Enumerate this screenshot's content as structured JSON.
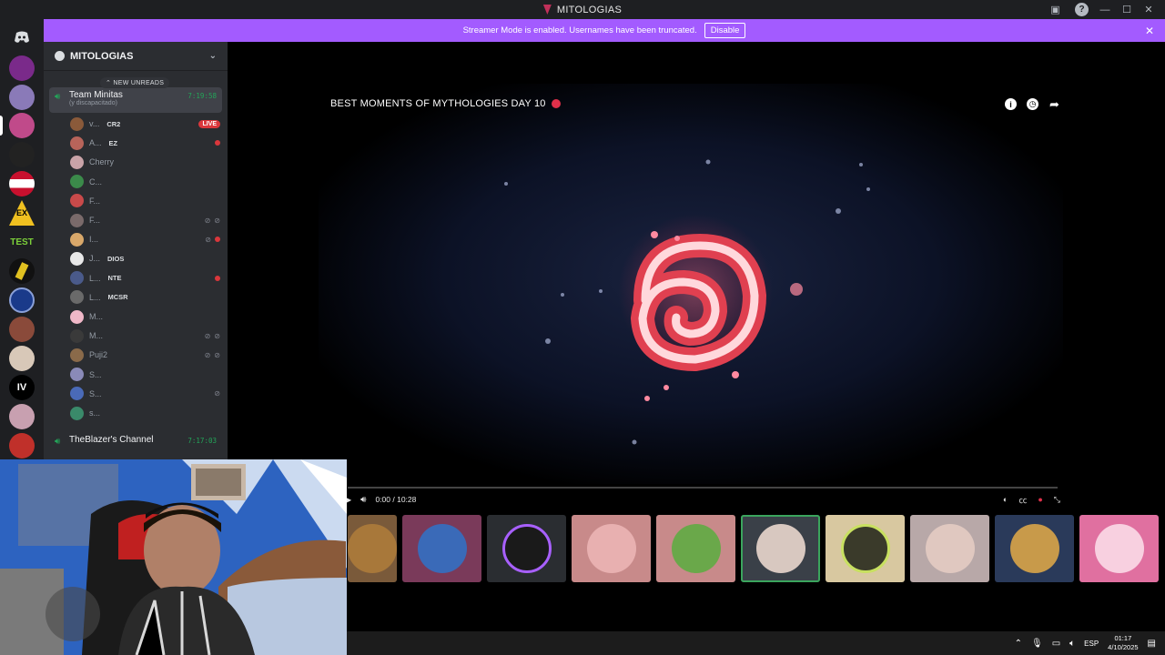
{
  "window": {
    "title": "MITOLOGIAS"
  },
  "banner": {
    "text": "Streamer Mode is enabled. Usernames have been truncated.",
    "disable_label": "Disable"
  },
  "server": {
    "name": "MITOLOGIAS"
  },
  "sidebar": {
    "new_unreads": "NEW UNREADS",
    "channels": [
      {
        "name": "Team Minitas",
        "subtitle": "(y discapacitado)",
        "time": "7:19:58"
      },
      {
        "name": "TheBlazer's Channel",
        "subtitle": "",
        "time": "7:17:03"
      }
    ],
    "members": [
      {
        "name": "v...",
        "tag": "CR2",
        "badge": "LIVE",
        "avatar": "#8a5a3a"
      },
      {
        "name": "A...",
        "tag": "EZ",
        "badge": "dot",
        "avatar": "#b8645a"
      },
      {
        "name": "Cherry",
        "tag": "",
        "badge": "",
        "avatar": "#c9a3a8"
      },
      {
        "name": "C...",
        "tag": "",
        "badge": "",
        "avatar": "#3b8a4a"
      },
      {
        "name": "F...",
        "tag": "",
        "badge": "",
        "avatar": "#c94a4a"
      },
      {
        "name": "F...",
        "tag": "",
        "badge": "muted",
        "avatar": "#7a6a6a"
      },
      {
        "name": "I...",
        "tag": "",
        "badge": "muted-dot",
        "avatar": "#d9a86a"
      },
      {
        "name": "J...",
        "tag": "DIOS",
        "badge": "",
        "avatar": "#e8e8e8"
      },
      {
        "name": "L...",
        "tag": "NTE",
        "badge": "dot",
        "avatar": "#4a5a8a"
      },
      {
        "name": "L...",
        "tag": "MCSR",
        "badge": "",
        "avatar": "#6a6a6a"
      },
      {
        "name": "M...",
        "tag": "",
        "badge": "",
        "avatar": "#f0b8c8"
      },
      {
        "name": "M...",
        "tag": "",
        "badge": "muted",
        "avatar": "#3a3a3a"
      },
      {
        "name": "Puji2",
        "tag": "",
        "badge": "muted",
        "avatar": "#8a6a4a"
      },
      {
        "name": "S...",
        "tag": "",
        "badge": "",
        "avatar": "#8a8ab8"
      },
      {
        "name": "S...",
        "tag": "",
        "badge": "mute-mic",
        "avatar": "#4a6ab8"
      },
      {
        "name": "s...",
        "tag": "",
        "badge": "",
        "avatar": "#3a8a6a"
      }
    ]
  },
  "video": {
    "title": "BEST MOMENTS OF MYTHOLOGIES DAY 10",
    "time": "0:00 / 10:28",
    "progress": 0
  },
  "taskbar": {
    "lang": "ESP",
    "time": "01:17",
    "date": "4/10/2025"
  }
}
